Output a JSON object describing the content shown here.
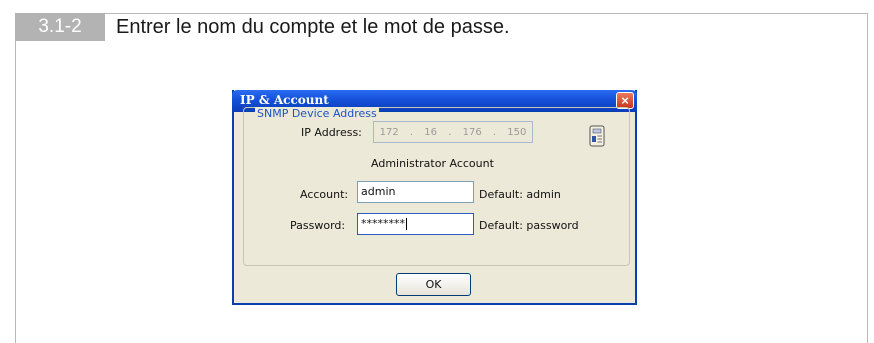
{
  "step": {
    "number": "3.1-2",
    "instruction": "Entrer le nom du compte et le mot de passe."
  },
  "dialog": {
    "title": "IP & Account",
    "close_symbol": "×",
    "group_title": "SNMP Device Address",
    "ip_label": "IP Address:",
    "ip_octets": [
      "172",
      "16",
      "176",
      "150"
    ],
    "ip_separator": ".",
    "admin_heading": "Administrator Account",
    "account_label": "Account:",
    "account_value": "admin",
    "account_default": "Default: admin",
    "password_label": "Password:",
    "password_value": "********",
    "password_default": "Default: password",
    "ok_label": "OK",
    "icon": "device-info-icon"
  },
  "colors": {
    "titlebar": "#0a3fb0",
    "dialog_bg": "#ece9d8",
    "legend": "#1a55c5",
    "badge": "#b3b3b3"
  }
}
